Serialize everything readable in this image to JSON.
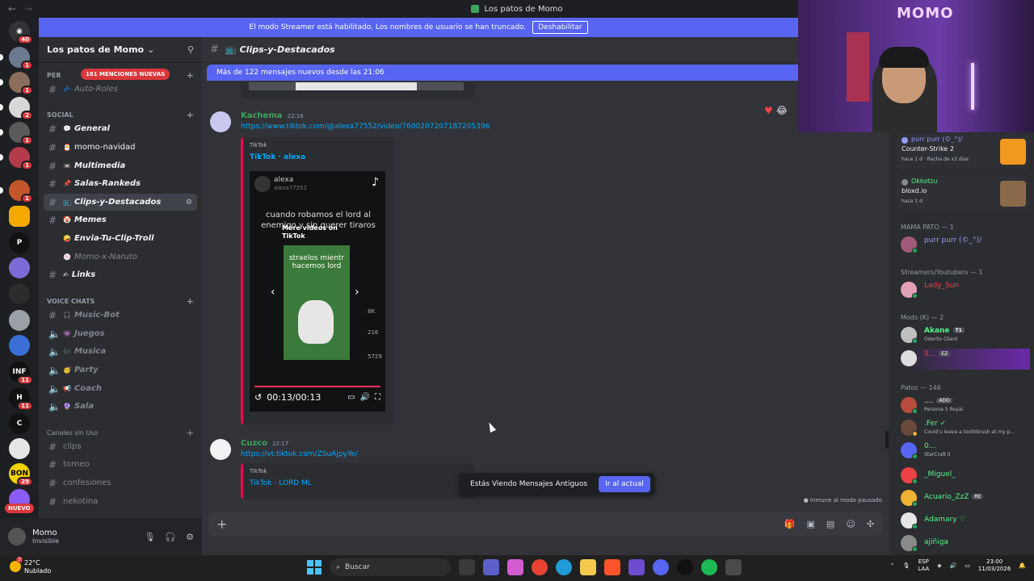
{
  "window": {
    "title": "Los patos de Momo"
  },
  "banner": {
    "text": "El modo Streamer está habilitado. Los nombres de usuario se han truncado.",
    "button": "Deshabilitar"
  },
  "server_badges": {
    "top": "40",
    "s1": "1",
    "s2": "1",
    "s3": "2",
    "s4": "1",
    "s5": "1",
    "s6": "1",
    "s7": "11",
    "s8": "11",
    "s9": "29",
    "nuevo": "NUEVO"
  },
  "guild": {
    "name": "Los patos de Momo"
  },
  "mentions_pill": "161 MENCIONES NUEVAS",
  "categories": {
    "per": "PER",
    "social": "SOCIAL",
    "voice": "VOICE CHATS",
    "sin_uso": "Canales sin Uso"
  },
  "channels": {
    "auto_roles": "Auto-Roles",
    "general": "General",
    "momo_navidad": "momo-navidad",
    "multimedia": "Multimedia",
    "salas_rankeds": "Salas-Rankeds",
    "clips": "Clips-y-Destacados",
    "memes": "Memes",
    "envia_clip": "Envia-Tu-Clip-Troll",
    "momo_naruto": "Momo-x-Naruto",
    "links": "Links",
    "music_bot": "Music-Bot",
    "juegos": "Juegos",
    "musica": "Musica",
    "party": "Party",
    "coach": "Coach",
    "sala": "Sala",
    "clips_unused": "clips",
    "torneo": "torneo",
    "confesiones": "confesiones",
    "nekotina": "nekotina"
  },
  "user": {
    "name": "Momo",
    "status": "Invisible"
  },
  "header": {
    "channel": "Clips-y-Destacados"
  },
  "new_messages_bar": "Más de 122 mensajes nuevos desde las 21:06",
  "messages": [
    {
      "author": "Kachema",
      "time": "22:16",
      "link": "https://www.tiktok.com/@alexa77552/video/7600207207187205396",
      "embed": {
        "provider": "TikTok",
        "title": "TikTok · alexa",
        "video": {
          "user": "alexa",
          "handle": "alexa77552",
          "caption": "cuando robamos el lord al enemigo y sin querer tiraros",
          "more": "More videos on TikTok",
          "thumb_text": "straelos mientr hacemos lord",
          "likes": "8K",
          "comments": "216",
          "shares": "5729",
          "time": "00:13/00:13"
        }
      }
    },
    {
      "author": "Cuzco",
      "time": "22:17",
      "link": "https://vt.tiktok.com/ZSuAjpyYe/",
      "embed": {
        "provider": "TikTok",
        "title": "TikTok · LORD ML"
      }
    }
  ],
  "toast": {
    "text": "Estás Viendo Mensajes Antiguos",
    "button": "Ir al actual"
  },
  "slowmode": "Inmune al modo pausado",
  "stream_overlay": {
    "sign": "MOMO"
  },
  "activities": [
    {
      "who": "purr purr (©_°)/",
      "game": "Counter-Strike 2",
      "meta": "hace 1 d · Racha de x3 días"
    },
    {
      "who": "Okkotzu",
      "game": "bloxd.io",
      "meta": "hace 1 d"
    }
  ],
  "groups": {
    "mama_pato": "MAMA PATO — 1",
    "streamers": "Streamers/Youtubers — 1",
    "mods": "Mods (K) — 2",
    "patos": "Patos — 146"
  },
  "members": {
    "purr": {
      "name": "purr purr (©_°)/",
      "color": "#949cf7"
    },
    "lady": {
      "name": "Lady_Sun",
      "color": "#ed4245"
    },
    "akane": {
      "name": "Akane",
      "tag": "T1",
      "status": "OderSo Client",
      "color": "#57f287"
    },
    "s": {
      "name": "S...",
      "tag": "EZ",
      "color": "#ed4245"
    },
    "m1": {
      "name": "....",
      "tag": "ADO",
      "status": "Persona 5 Royal",
      "color": "#f2f3f5"
    },
    "fer": {
      "name": ".Fer ✓",
      "status": "Could u leave a toothbrush at my p...",
      "color": "#57f287"
    },
    "o": {
      "name": "0...",
      "status": "StarCraft II",
      "color": "#57f287"
    },
    "miguel": {
      "name": "_Miguel_",
      "color": "#57f287"
    },
    "acuario": {
      "name": "Acuario_ZzZ",
      "tag": "RE",
      "color": "#57f287"
    },
    "adamary": {
      "name": "Adamary ♡",
      "color": "#57f287"
    },
    "ajiniga": {
      "name": "ajiñiga",
      "color": "#57f287"
    }
  },
  "taskbar": {
    "temp": "22°C",
    "weather": "Nublado",
    "weather_badge": "3",
    "search": "Buscar",
    "lang": "ESP",
    "lang2": "LAA",
    "time": "23:00",
    "date": "11/03/2026"
  }
}
